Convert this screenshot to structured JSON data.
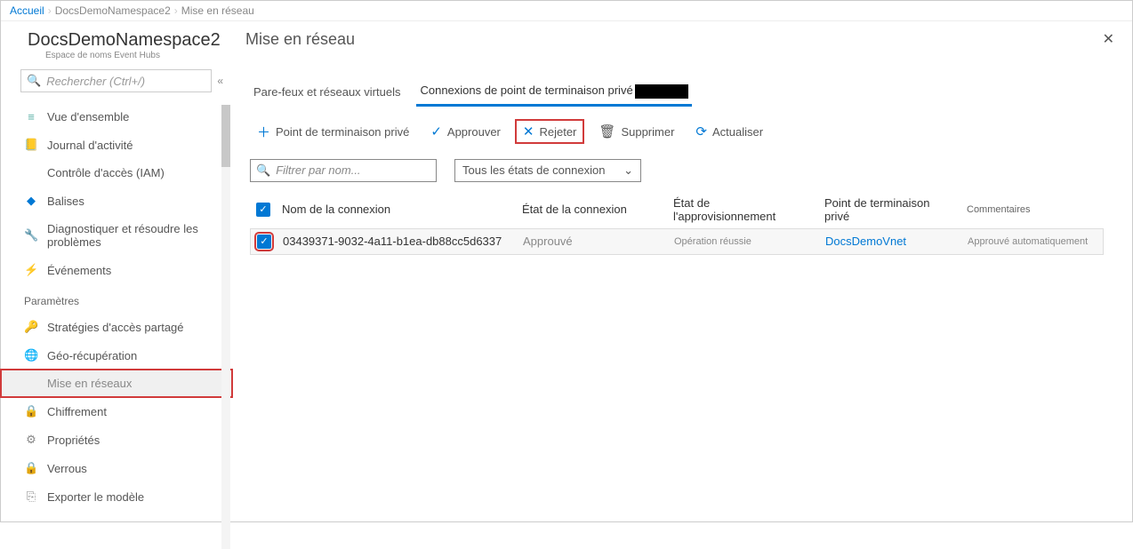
{
  "breadcrumb": {
    "home": "Accueil",
    "ns": "DocsDemoNamespace2",
    "page": "Mise en réseau"
  },
  "header": {
    "title": "DocsDemoNamespace2",
    "subtitle": "Espace de noms Event Hubs",
    "page": "Mise en réseau"
  },
  "sidebar": {
    "search_placeholder": "Rechercher (Ctrl+/)",
    "items": [
      {
        "icon": "≡",
        "cls": "ic-teal",
        "label": "Vue d'ensemble"
      },
      {
        "icon": "📒",
        "cls": "ic-blue",
        "label": "Journal d'activité"
      },
      {
        "icon": "",
        "cls": "",
        "label": "Contrôle d'accès (IAM)"
      },
      {
        "icon": "◆",
        "cls": "ic-blue",
        "label": "Balises"
      },
      {
        "icon": "🔧",
        "cls": "ic-gray",
        "label": "Diagnostiquer et résoudre les problèmes"
      },
      {
        "icon": "⚡",
        "cls": "ic-yellow",
        "label": "Événements"
      }
    ],
    "section": "Paramètres",
    "settings": [
      {
        "icon": "🔑",
        "cls": "ic-orange",
        "label": "Stratégies d'accès partagé"
      },
      {
        "icon": "🌐",
        "cls": "ic-globe",
        "label": "Géo-récupération"
      },
      {
        "icon": "",
        "cls": "",
        "label": "Mise en réseaux",
        "selected": true
      },
      {
        "icon": "🔒",
        "cls": "ic-gray",
        "label": "Chiffrement"
      },
      {
        "icon": "⚙",
        "cls": "ic-gray",
        "label": "Propriétés"
      },
      {
        "icon": "🔒",
        "cls": "ic-gray",
        "label": "Verrous"
      },
      {
        "icon": "⎘",
        "cls": "ic-gray",
        "label": "Exporter le modèle"
      }
    ]
  },
  "tabs": {
    "t1": "Pare-feux et réseaux virtuels",
    "t2": "Connexions de point de terminaison privé"
  },
  "toolbar": {
    "add": "Point de terminaison privé",
    "approve": "Approuver",
    "reject": "Rejeter",
    "delete": "Supprimer",
    "refresh": "Actualiser"
  },
  "filters": {
    "name_placeholder": "Filtrer par nom...",
    "state_label": "Tous les états de connexion"
  },
  "table": {
    "headers": {
      "name": "Nom de la connexion",
      "state": "État de la connexion",
      "prov": "État de l'approvisionnement",
      "endpoint": "Point de terminaison privé",
      "comments": "Commentaires"
    },
    "row": {
      "name": "03439371-9032-4a11-b1ea-db88cc5d6337",
      "state": "Approuvé",
      "prov": "Opération réussie",
      "endpoint": "DocsDemoVnet",
      "comments": "Approuvé automatiquement"
    }
  }
}
